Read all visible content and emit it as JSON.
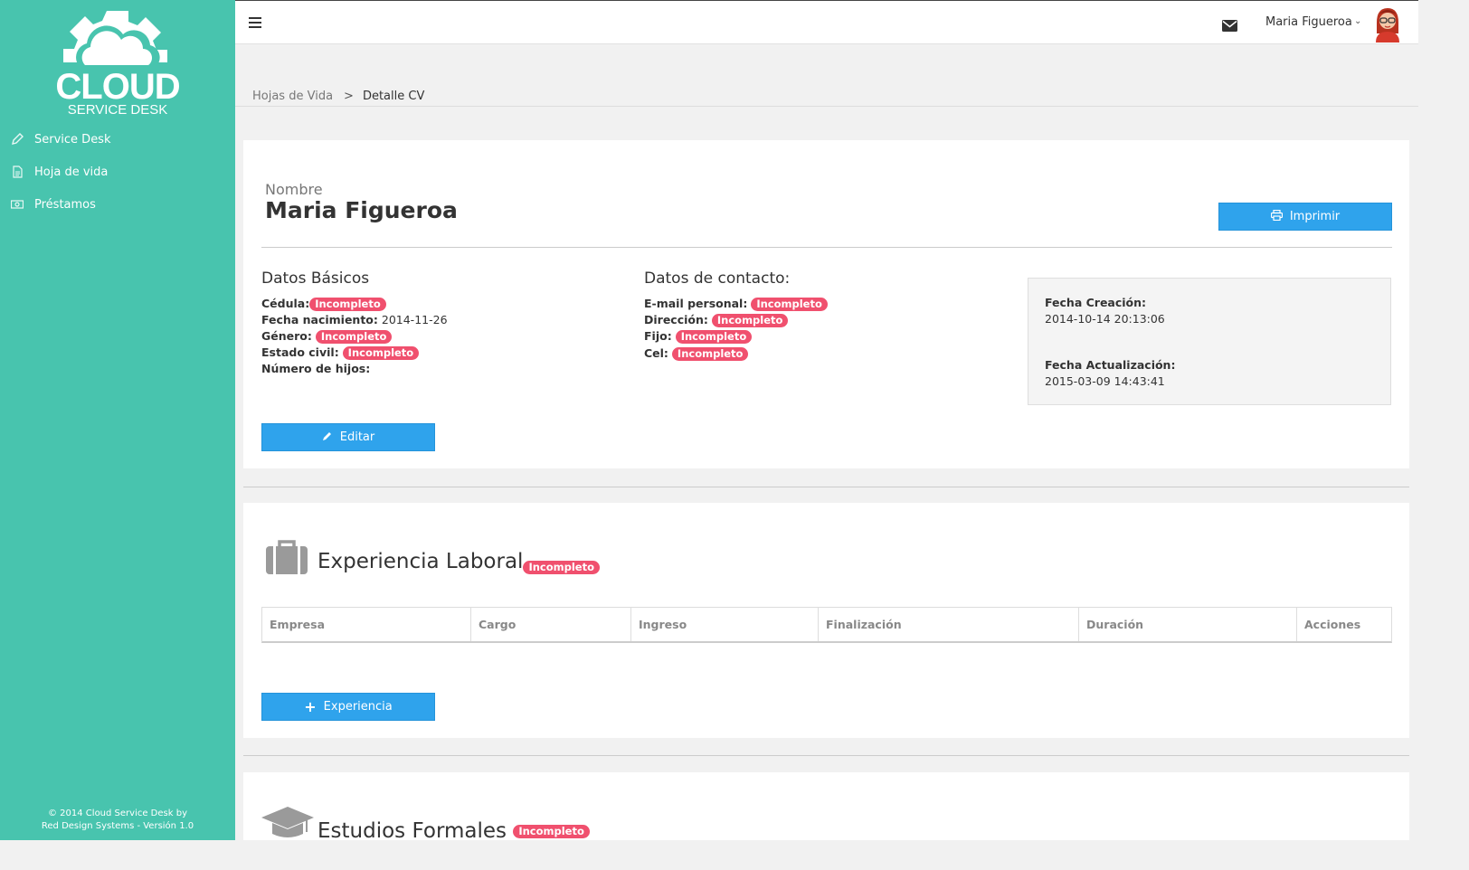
{
  "sidebar": {
    "logo_title": "CLOUD",
    "logo_subtitle": "SERVICE DESK",
    "items": [
      {
        "label": "Service Desk",
        "icon": "pencil-icon"
      },
      {
        "label": "Hoja de vida",
        "icon": "document-icon"
      },
      {
        "label": "Préstamos",
        "icon": "money-icon"
      }
    ],
    "footer_line1": "© 2014 Cloud Service Desk by",
    "footer_line2": "Red Design Systems - Versión 1.0"
  },
  "topbar": {
    "user_name": "Maria Figueroa"
  },
  "breadcrumb": {
    "parent": "Hojas de Vida",
    "separator": ">",
    "current": "Detalle CV"
  },
  "profile": {
    "name_label": "Nombre",
    "name_value": "Maria Figueroa",
    "print_label": "Imprimir",
    "basic": {
      "title": "Datos Básicos",
      "cedula_label": "Cédula:",
      "cedula_value": "Incompleto",
      "birth_label": "Fecha nacimiento:",
      "birth_value": "2014-11-26",
      "gender_label": "Género:",
      "gender_value": "Incompleto",
      "civil_label": "Estado civil:",
      "civil_value": "Incompleto",
      "children_label": "Número de hijos:"
    },
    "contact": {
      "title": "Datos de contacto:",
      "email_label": "E-mail personal:",
      "email_value": "Incompleto",
      "address_label": "Dirección:",
      "address_value": "Incompleto",
      "phone_label": "Fijo:",
      "phone_value": "Incompleto",
      "cell_label": "Cel:",
      "cell_value": "Incompleto"
    },
    "dates": {
      "created_label": "Fecha Creación:",
      "created_value": "2014-10-14 20:13:06",
      "updated_label": "Fecha Actualización:",
      "updated_value": "2015-03-09 14:43:41"
    },
    "edit_label": "Editar"
  },
  "experience": {
    "title": "Experiencia Laboral",
    "status": "Incompleto",
    "columns": [
      "Empresa",
      "Cargo",
      "Ingreso",
      "Finalización",
      "Duración",
      "Acciones"
    ],
    "add_label": "Experiencia"
  },
  "education": {
    "title": "Estudios Formales",
    "status": "Incompleto"
  },
  "colors": {
    "sidebar": "#48c4ae",
    "button": "#2fa3ec",
    "badge": "#f0506e"
  }
}
